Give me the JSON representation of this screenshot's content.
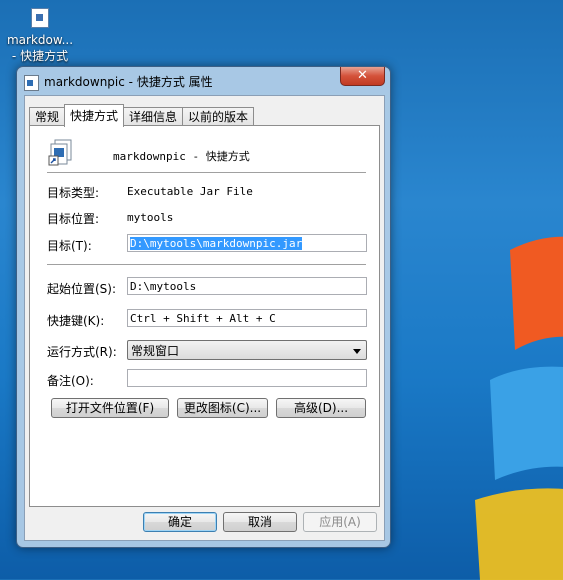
{
  "desktop": {
    "icon_label_line1": "markdow...",
    "icon_label_line2": "- 快捷方式"
  },
  "window": {
    "title": "markdownpic - 快捷方式 属性",
    "close_glyph": "✕"
  },
  "tabs": [
    {
      "label": "常规"
    },
    {
      "label": "快捷方式"
    },
    {
      "label": "详细信息"
    },
    {
      "label": "以前的版本"
    }
  ],
  "shortcut": {
    "name": "markdownpic - 快捷方式",
    "target_type_label": "目标类型:",
    "target_type_value": "Executable Jar File",
    "target_location_label": "目标位置:",
    "target_location_value": "mytools",
    "target_label": "目标(T):",
    "target_value": "D:\\mytools\\markdownpic.jar",
    "start_in_label": "起始位置(S):",
    "start_in_value": "D:\\mytools",
    "hotkey_label": "快捷键(K):",
    "hotkey_value": "Ctrl + Shift + Alt + C",
    "run_label": "运行方式(R):",
    "run_value": "常规窗口",
    "comment_label": "备注(O):",
    "comment_value": ""
  },
  "actions": {
    "open_location": "打开文件位置(F)",
    "change_icon": "更改图标(C)...",
    "advanced": "高级(D)..."
  },
  "dialog_buttons": {
    "ok": "确定",
    "cancel": "取消",
    "apply": "应用(A)"
  }
}
